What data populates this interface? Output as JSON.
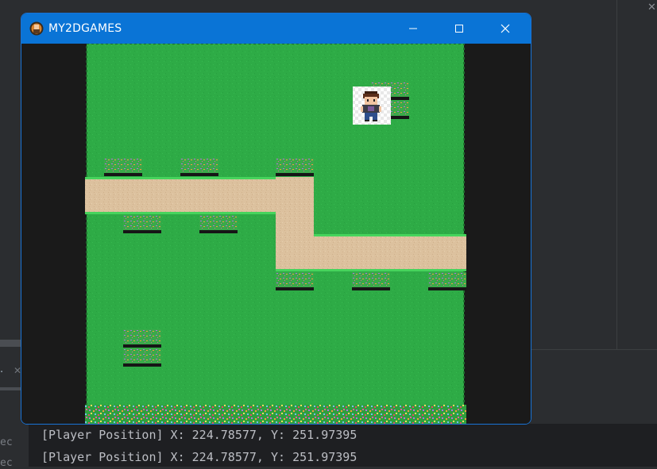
{
  "window": {
    "title": "MY2DGAMES"
  },
  "console": {
    "lines": [
      "[Player Position] X: 224.78577, Y: 251.97395",
      "[Player Position] X: 224.78577, Y: 251.97395"
    ],
    "gutter": [
      "ec",
      "ec"
    ]
  },
  "ide": {
    "tab_stub": "."
  },
  "colors": {
    "titlebar": "#0a74d6",
    "grass": "#2eab46",
    "path": "#dcc19e"
  }
}
